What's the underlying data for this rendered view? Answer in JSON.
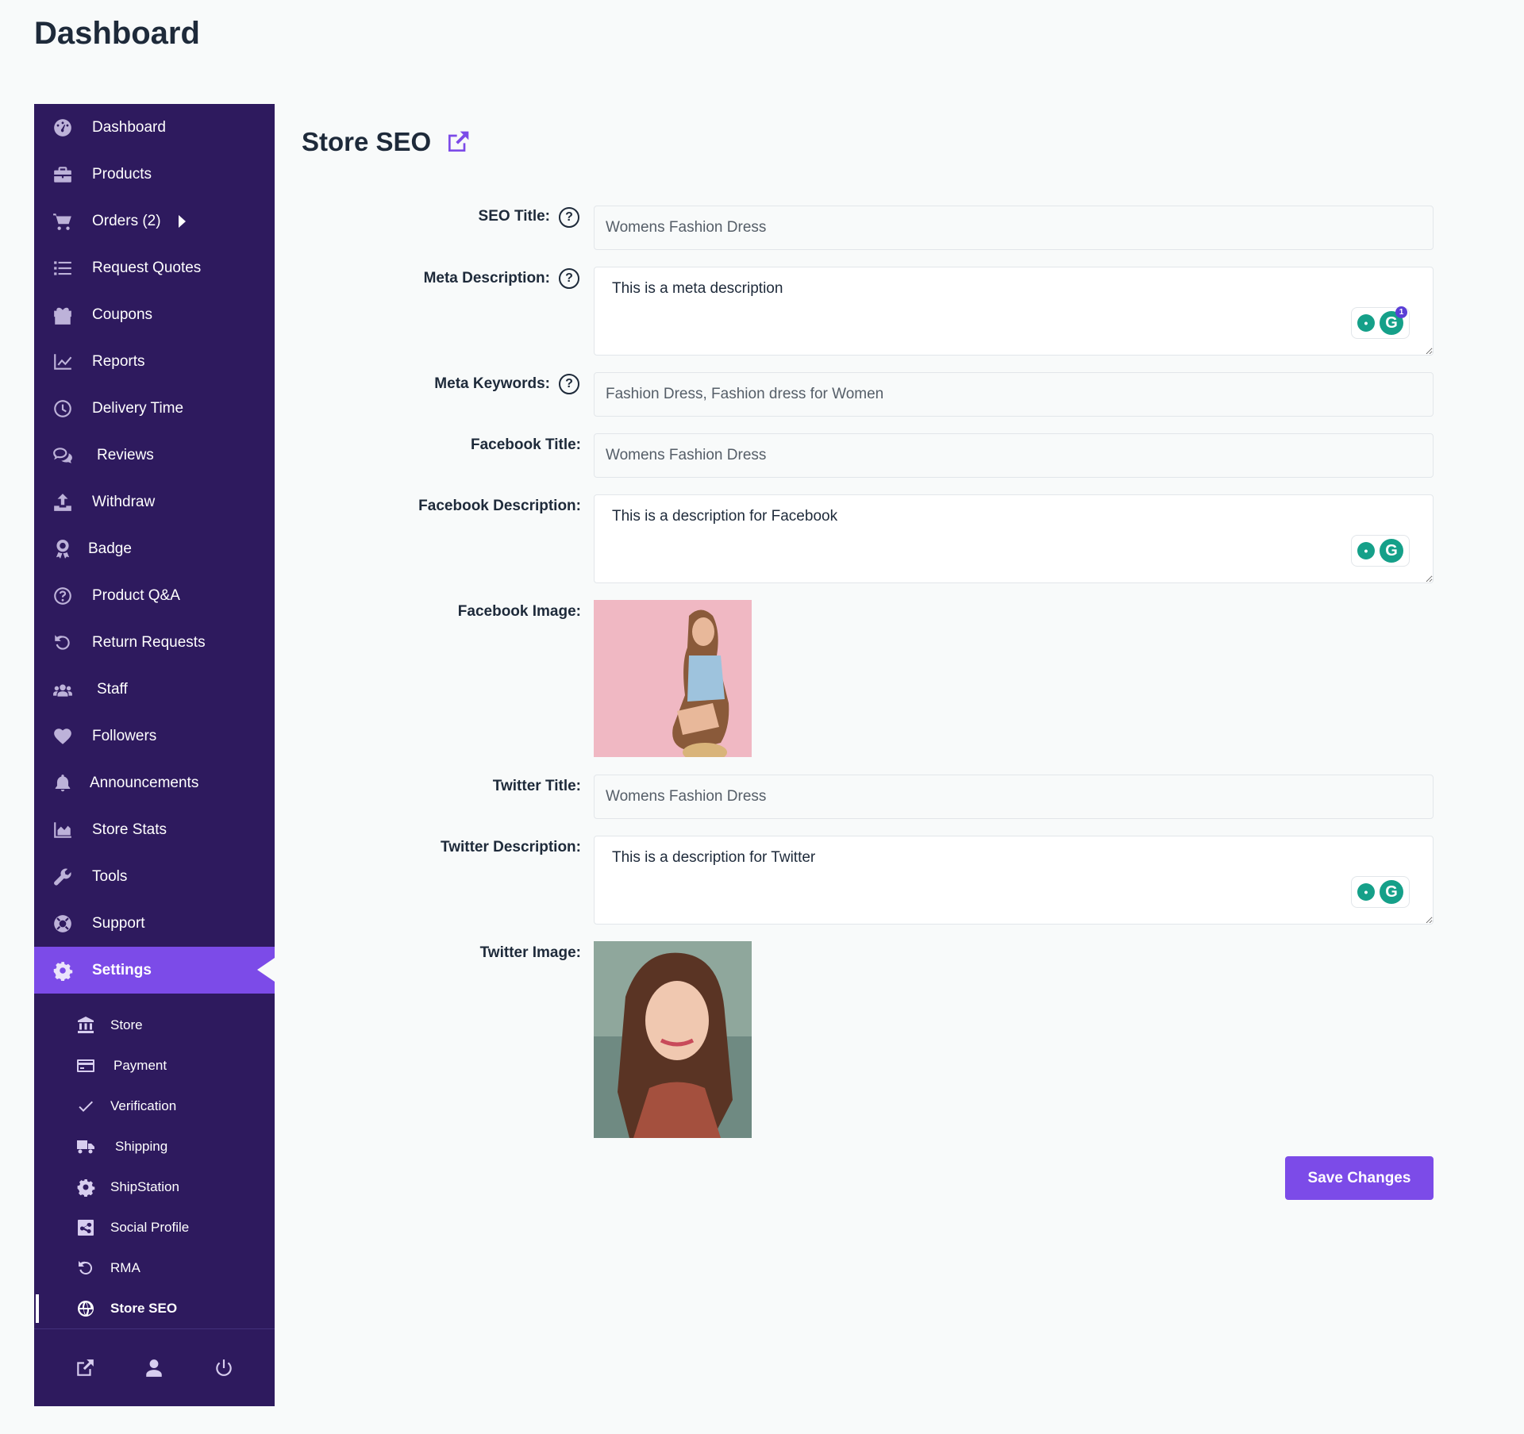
{
  "page_title": "Dashboard",
  "sidebar": {
    "items": [
      {
        "label": "Dashboard",
        "icon": "dashboard-gauge-icon"
      },
      {
        "label": "Products",
        "icon": "briefcase-icon"
      },
      {
        "label": "Orders (2)",
        "icon": "cart-icon"
      },
      {
        "label": "Request Quotes",
        "icon": "list-icon"
      },
      {
        "label": "Coupons",
        "icon": "gift-icon"
      },
      {
        "label": "Reports",
        "icon": "line-chart-icon"
      },
      {
        "label": "Delivery Time",
        "icon": "clock-icon"
      },
      {
        "label": "Reviews",
        "icon": "comments-icon"
      },
      {
        "label": "Withdraw",
        "icon": "upload-icon"
      },
      {
        "label": "Badge",
        "icon": "award-icon"
      },
      {
        "label": "Product Q&A",
        "icon": "question-circle-icon"
      },
      {
        "label": "Return Requests",
        "icon": "undo-icon"
      },
      {
        "label": "Staff",
        "icon": "users-icon"
      },
      {
        "label": "Followers",
        "icon": "heart-icon"
      },
      {
        "label": "Announcements",
        "icon": "bell-icon"
      },
      {
        "label": "Store Stats",
        "icon": "area-chart-icon"
      },
      {
        "label": "Tools",
        "icon": "wrench-icon"
      },
      {
        "label": "Support",
        "icon": "lifebuoy-icon"
      },
      {
        "label": "Settings",
        "icon": "gear-icon"
      }
    ],
    "settings_items": [
      {
        "label": "Store",
        "icon": "bank-icon"
      },
      {
        "label": "Payment",
        "icon": "credit-card-icon"
      },
      {
        "label": "Verification",
        "icon": "check-icon"
      },
      {
        "label": "Shipping",
        "icon": "truck-icon"
      },
      {
        "label": "ShipStation",
        "icon": "gear-icon"
      },
      {
        "label": "Social Profile",
        "icon": "share-icon"
      },
      {
        "label": "RMA",
        "icon": "undo-icon"
      },
      {
        "label": "Store SEO",
        "icon": "globe-icon"
      }
    ],
    "footer": [
      "external-link-icon",
      "user-icon",
      "power-icon"
    ]
  },
  "main": {
    "title": "Store SEO",
    "fields": {
      "seo_title_label": "SEO Title:",
      "seo_title_value": "Womens Fashion Dress",
      "meta_description_label": "Meta Description:",
      "meta_description_value": "This is a meta description",
      "meta_keywords_label": "Meta Keywords:",
      "meta_keywords_value": "Fashion Dress, Fashion dress for Women",
      "facebook_title_label": "Facebook Title:",
      "facebook_title_value": "Womens Fashion Dress",
      "facebook_description_label": "Facebook Description:",
      "facebook_description_value": "This is a description for Facebook",
      "facebook_image_label": "Facebook Image:",
      "twitter_title_label": "Twitter Title:",
      "twitter_title_value": "Womens Fashion Dress",
      "twitter_description_label": "Twitter Description:",
      "twitter_description_value": "This is a description for Twitter",
      "twitter_image_label": "Twitter Image:"
    },
    "help_glyph": "?",
    "grammarly_badge": "1",
    "save_label": "Save Changes"
  },
  "colors": {
    "sidebar_bg": "#2e1a5e",
    "accent": "#7c4be8",
    "grammarly": "#15a089"
  }
}
